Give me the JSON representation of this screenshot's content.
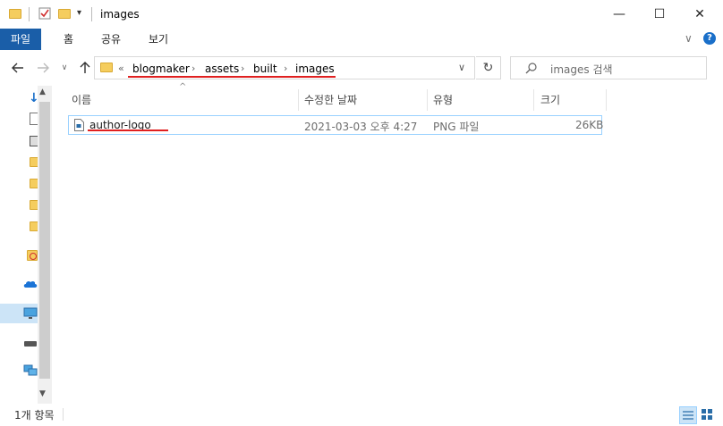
{
  "window": {
    "title": "images",
    "controls": {
      "minimize": "—",
      "maximize": "☐",
      "close": "✕"
    }
  },
  "ribbon": {
    "tabs": [
      {
        "label": "파일",
        "active": true
      },
      {
        "label": "홈"
      },
      {
        "label": "공유"
      },
      {
        "label": "보기"
      }
    ]
  },
  "nav": {
    "overflow": "«",
    "breadcrumb": [
      "blogmaker",
      "assets",
      "built",
      "images"
    ],
    "search_placeholder": "images 검색"
  },
  "columns": [
    {
      "label": "이름"
    },
    {
      "label": "수정한 날짜"
    },
    {
      "label": "유형"
    },
    {
      "label": "크기"
    }
  ],
  "files": [
    {
      "name": "author-logo",
      "modified": "2021-03-03 오후 4:27",
      "type": "PNG 파일",
      "size": "26KB"
    }
  ],
  "status": {
    "item_count": "1개 항목"
  },
  "colors": {
    "accent": "#1a5ea8",
    "selection_border": "#99d1ff",
    "annotation": "#e02020",
    "folder": "#f5cd5e"
  }
}
